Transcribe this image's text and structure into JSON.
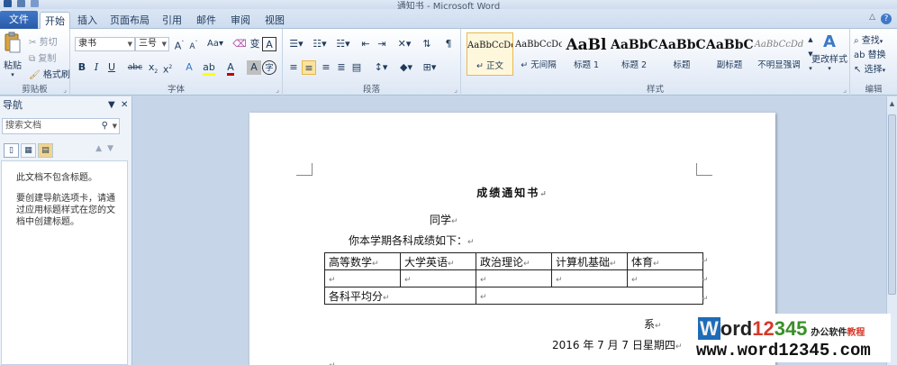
{
  "window": {
    "title": "通知书 - Microsoft Word"
  },
  "ribbon_tabs": [
    "文件",
    "开始",
    "插入",
    "页面布局",
    "引用",
    "邮件",
    "审阅",
    "视图"
  ],
  "clipboard": {
    "paste": "粘贴",
    "cut": "剪切",
    "copy": "复制",
    "format_painter": "格式刷",
    "label": "剪贴板"
  },
  "font": {
    "name": "隶书",
    "size": "三号",
    "label": "字体",
    "font_color": "#c00000",
    "highlight_color": "#ffff00"
  },
  "paragraph": {
    "label": "段落"
  },
  "styles": {
    "label": "样式",
    "items": [
      {
        "sample": "AaBbCcDc",
        "name": "↵ 正文"
      },
      {
        "sample": "AaBbCcDc",
        "name": "↵ 无间隔"
      },
      {
        "sample": "AaBl",
        "name": "标题 1"
      },
      {
        "sample": "AaBbC",
        "name": "标题 2"
      },
      {
        "sample": "AaBbC",
        "name": "标题"
      },
      {
        "sample": "AaBbC",
        "name": "副标题"
      },
      {
        "sample": "AaBbCcDd",
        "name": "不明显强调"
      }
    ],
    "change_styles": "更改样式"
  },
  "editing": {
    "find": "查找",
    "replace": "替换",
    "select": "选择",
    "label": "编辑"
  },
  "nav_pane": {
    "title": "导航",
    "search_placeholder": "搜索文档",
    "msg1": "此文档不包含标题。",
    "msg2": "要创建导航选项卡，请通过应用标题样式在您的文档中创建标题。"
  },
  "document": {
    "title": "成绩通知书",
    "greeting": "同学",
    "intro": "你本学期各科成绩如下：",
    "table_headers": [
      "高等数学",
      "大学英语",
      "政治理论",
      "计算机基础",
      "体育"
    ],
    "average_label": "各科平均分",
    "department": "系",
    "date": "2016 年 7 月 7 日星期四"
  },
  "watermark": {
    "brand_a": "W",
    "brand_b": "ord",
    "brand_c": "12",
    "brand_d": "345",
    "tag1": "办公软件",
    "tag2": "教程",
    "url": "www.word12345.com"
  }
}
